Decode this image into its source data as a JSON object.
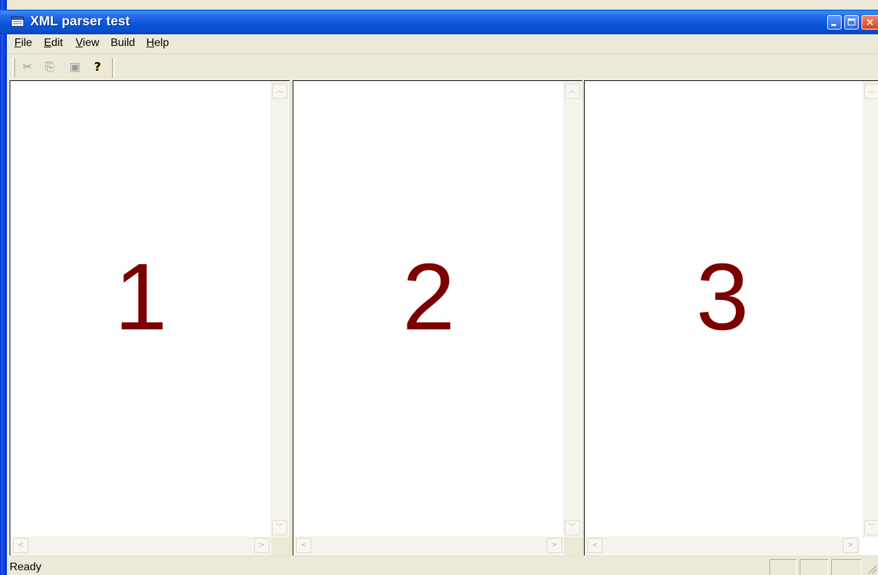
{
  "window": {
    "title": "XML parser test",
    "close_glyph": "×"
  },
  "menu": [
    {
      "label_u": "F",
      "label_rest": "ile"
    },
    {
      "label_u": "E",
      "label_rest": "dit"
    },
    {
      "label_u": "V",
      "label_rest": "iew"
    },
    {
      "label_u": "",
      "label_rest": "Build"
    },
    {
      "label_u": "H",
      "label_rest": "elp"
    }
  ],
  "toolbar": {
    "icons": [
      "cut-icon",
      "copy-icon",
      "paste-icon",
      "help-icon"
    ]
  },
  "panes": [
    {
      "label": "1"
    },
    {
      "label": "2"
    },
    {
      "label": "3"
    }
  ],
  "status": {
    "text": "Ready"
  },
  "colors": {
    "pane_number": "#7b0000",
    "titlebar": "#0a50d0",
    "chrome": "#ece9d8"
  }
}
